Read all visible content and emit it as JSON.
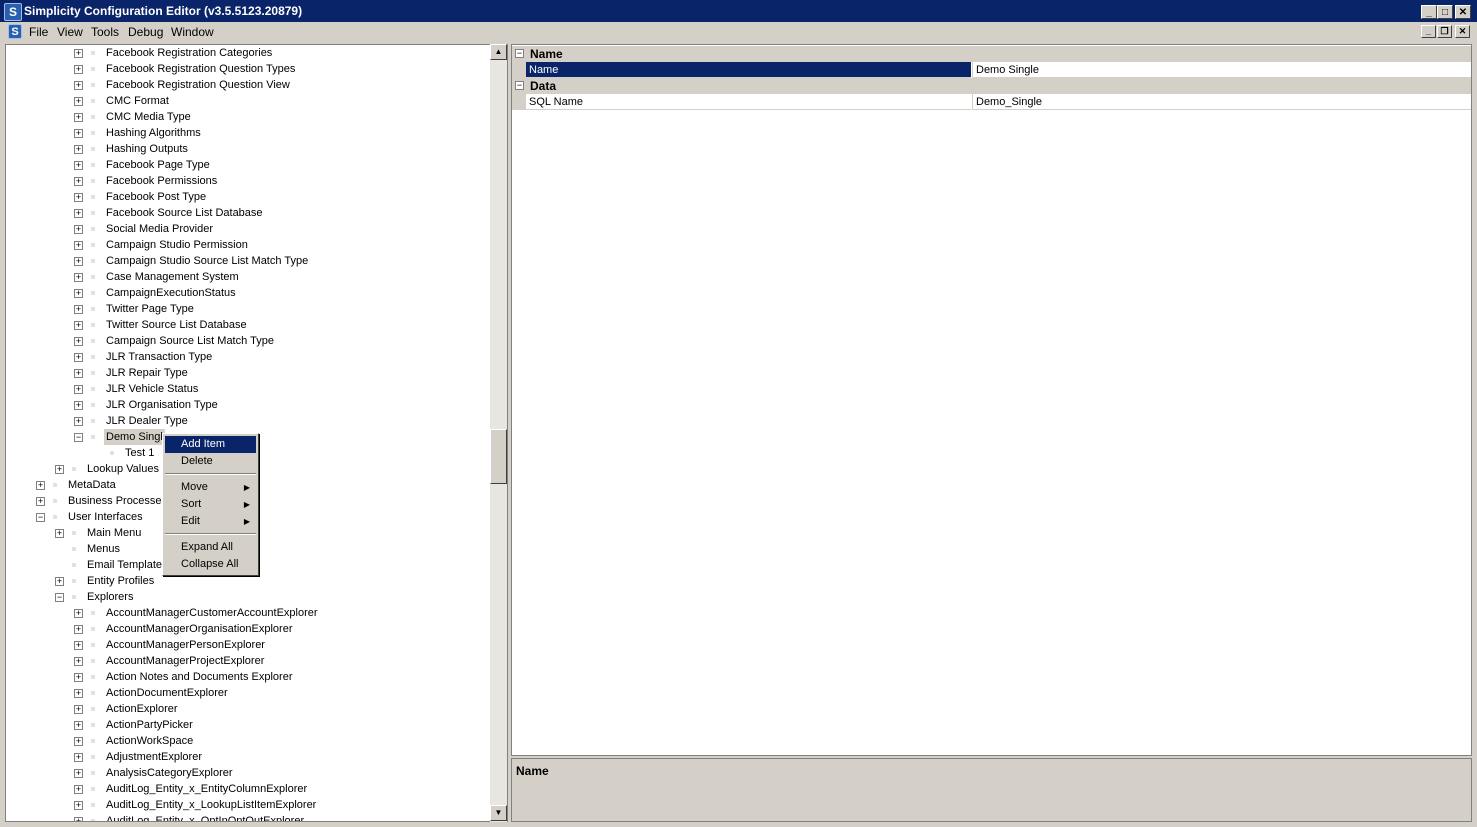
{
  "window": {
    "title": "Simplicity Configuration Editor (v3.5.5123.20879)",
    "app_icon_letter": "S"
  },
  "menu": {
    "items": [
      "File",
      "View",
      "Tools",
      "Debug",
      "Window"
    ]
  },
  "tree": {
    "items": [
      {
        "label": "Facebook Registration Categories",
        "level": 3,
        "expander": "+"
      },
      {
        "label": "Facebook Registration Question Types",
        "level": 3,
        "expander": "+"
      },
      {
        "label": "Facebook Registration Question View",
        "level": 3,
        "expander": "+"
      },
      {
        "label": "CMC Format",
        "level": 3,
        "expander": "+"
      },
      {
        "label": "CMC Media Type",
        "level": 3,
        "expander": "+"
      },
      {
        "label": "Hashing Algorithms",
        "level": 3,
        "expander": "+"
      },
      {
        "label": "Hashing Outputs",
        "level": 3,
        "expander": "+"
      },
      {
        "label": "Facebook Page Type",
        "level": 3,
        "expander": "+"
      },
      {
        "label": "Facebook Permissions",
        "level": 3,
        "expander": "+"
      },
      {
        "label": "Facebook Post Type",
        "level": 3,
        "expander": "+"
      },
      {
        "label": "Facebook Source List Database",
        "level": 3,
        "expander": "+"
      },
      {
        "label": "Social Media Provider",
        "level": 3,
        "expander": "+"
      },
      {
        "label": "Campaign Studio Permission",
        "level": 3,
        "expander": "+"
      },
      {
        "label": "Campaign Studio Source List Match Type",
        "level": 3,
        "expander": "+"
      },
      {
        "label": "Case Management System",
        "level": 3,
        "expander": "+"
      },
      {
        "label": "CampaignExecutionStatus",
        "level": 3,
        "expander": "+"
      },
      {
        "label": "Twitter Page Type",
        "level": 3,
        "expander": "+"
      },
      {
        "label": "Twitter Source List Database",
        "level": 3,
        "expander": "+"
      },
      {
        "label": "Campaign Source List Match Type",
        "level": 3,
        "expander": "+"
      },
      {
        "label": "JLR Transaction Type",
        "level": 3,
        "expander": "+"
      },
      {
        "label": "JLR Repair Type",
        "level": 3,
        "expander": "+"
      },
      {
        "label": "JLR Vehicle Status",
        "level": 3,
        "expander": "+"
      },
      {
        "label": "JLR Organisation Type",
        "level": 3,
        "expander": "+"
      },
      {
        "label": "JLR Dealer Type",
        "level": 3,
        "expander": "+"
      },
      {
        "label": "Demo Singl",
        "level": 3,
        "expander": "-",
        "selected": true
      },
      {
        "label": "Test 1",
        "level": 4,
        "expander": ""
      },
      {
        "label": "Lookup Values",
        "level": 2,
        "expander": "+"
      },
      {
        "label": "MetaData",
        "level": 1,
        "expander": "+"
      },
      {
        "label": "Business Processes",
        "level": 1,
        "expander": "+"
      },
      {
        "label": "User Interfaces",
        "level": 1,
        "expander": "-"
      },
      {
        "label": "Main Menu",
        "level": 2,
        "expander": "+"
      },
      {
        "label": "Menus",
        "level": 2,
        "expander": ""
      },
      {
        "label": "Email Templates",
        "level": 2,
        "expander": ""
      },
      {
        "label": "Entity Profiles",
        "level": 2,
        "expander": "+"
      },
      {
        "label": "Explorers",
        "level": 2,
        "expander": "-"
      },
      {
        "label": "AccountManagerCustomerAccountExplorer",
        "level": 3,
        "expander": "+"
      },
      {
        "label": "AccountManagerOrganisationExplorer",
        "level": 3,
        "expander": "+"
      },
      {
        "label": "AccountManagerPersonExplorer",
        "level": 3,
        "expander": "+"
      },
      {
        "label": "AccountManagerProjectExplorer",
        "level": 3,
        "expander": "+"
      },
      {
        "label": "Action Notes and Documents Explorer",
        "level": 3,
        "expander": "+"
      },
      {
        "label": "ActionDocumentExplorer",
        "level": 3,
        "expander": "+"
      },
      {
        "label": "ActionExplorer",
        "level": 3,
        "expander": "+"
      },
      {
        "label": "ActionPartyPicker",
        "level": 3,
        "expander": "+"
      },
      {
        "label": "ActionWorkSpace",
        "level": 3,
        "expander": "+"
      },
      {
        "label": "AdjustmentExplorer",
        "level": 3,
        "expander": "+"
      },
      {
        "label": "AnalysisCategoryExplorer",
        "level": 3,
        "expander": "+"
      },
      {
        "label": "AuditLog_Entity_x_EntityColumnExplorer",
        "level": 3,
        "expander": "+"
      },
      {
        "label": "AuditLog_Entity_x_LookupListItemExplorer",
        "level": 3,
        "expander": "+"
      },
      {
        "label": "AuditLog_Entity_x_OptInOptOutExplorer",
        "level": 3,
        "expander": "+"
      }
    ]
  },
  "context_menu": {
    "items": [
      {
        "label": "Add Item",
        "active": true
      },
      {
        "label": "Delete"
      },
      {
        "separator": true
      },
      {
        "label": "Move",
        "submenu": true
      },
      {
        "label": "Sort",
        "submenu": true
      },
      {
        "label": "Edit",
        "submenu": true
      },
      {
        "separator": true
      },
      {
        "label": "Expand All"
      },
      {
        "label": "Collapse All"
      }
    ]
  },
  "properties": {
    "categories": [
      {
        "name": "Name",
        "rows": [
          {
            "name": "Name",
            "value": "Demo Single",
            "selected": true
          }
        ]
      },
      {
        "name": "Data",
        "rows": [
          {
            "name": "SQL Name",
            "value": "Demo_Single"
          }
        ]
      }
    ],
    "description_title": "Name"
  },
  "colors": {
    "titlebar": "#0a246a",
    "selection": "#0a246a",
    "face": "#d4d0c8"
  }
}
